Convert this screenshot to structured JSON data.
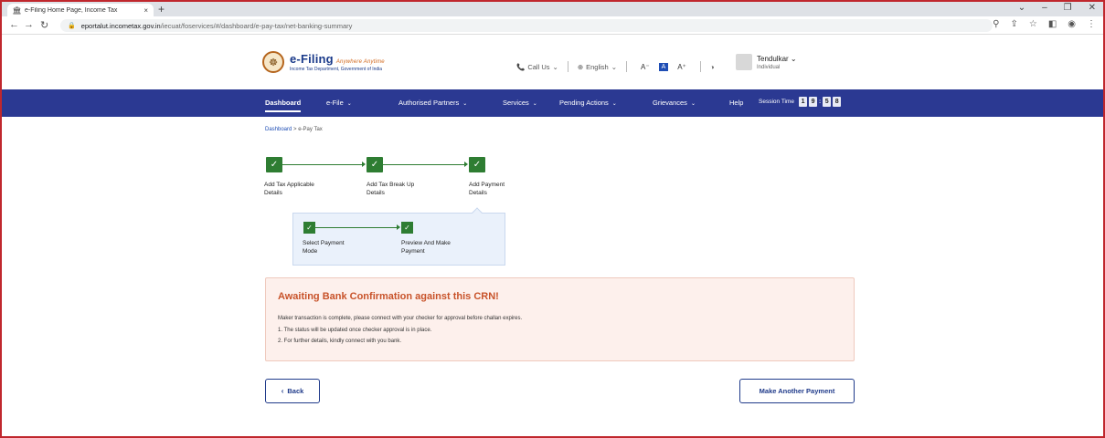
{
  "browser": {
    "tab_title": "e-Filing Home Page, Income Tax",
    "tab_close": "×",
    "new_tab": "+",
    "url_host": "eportalut.incometax.gov.in",
    "url_path": "/iecuat/foservices/#/dashboard/e-pay-tax/net-banking-summary",
    "icons": [
      "back-icon",
      "forward-icon",
      "reload-icon",
      "lock-icon",
      "zoom-icon",
      "share-icon",
      "star-icon",
      "sidepanel-icon",
      "profile-icon",
      "menu-icon"
    ]
  },
  "header": {
    "logo_main": "e-Filing",
    "logo_tagline": "Anywhere Anytime",
    "logo_sub": "Income Tax Department, Government of India",
    "call_us": "Call Us",
    "language": "English",
    "font_small": "A⁻",
    "font_normal": "A",
    "font_large": "A⁺",
    "user_name": "Tendulkar",
    "user_role": "Individual"
  },
  "nav": {
    "items": [
      {
        "label": "Dashboard",
        "caret": ""
      },
      {
        "label": "e-File",
        "caret": "⌄"
      },
      {
        "label": "Authorised Partners",
        "caret": "⌄"
      },
      {
        "label": "Services",
        "caret": "⌄"
      },
      {
        "label": "Pending Actions",
        "caret": "⌄"
      },
      {
        "label": "Grievances",
        "caret": "⌄"
      },
      {
        "label": "Help",
        "caret": ""
      }
    ],
    "session_label": "Session Time",
    "session_digits": [
      "1",
      "9",
      "5",
      "8"
    ]
  },
  "breadcrumb": {
    "home": "Dashboard",
    "separator": ">",
    "current": "e-Pay Tax"
  },
  "steps": [
    {
      "line1": "Add Tax Applicable",
      "line2": "Details"
    },
    {
      "line1": "Add Tax Break Up",
      "line2": "Details"
    },
    {
      "line1": "Add Payment",
      "line2": "Details"
    }
  ],
  "substeps": [
    {
      "line1": "Select Payment",
      "line2": "Mode"
    },
    {
      "line1": "Preview And Make",
      "line2": "Payment"
    }
  ],
  "alert": {
    "title": "Awaiting Bank Confirmation against this CRN!",
    "message": "Maker transaction is complete, please connect with your checker for approval before challan expires.",
    "point1": "1. The status will be updated once checker approval is in place.",
    "point2": "2. For further details, kindly connect with you bank."
  },
  "actions": {
    "back": "Back",
    "make_another": "Make Another Payment"
  },
  "colors": {
    "nav_bg": "#2b3992",
    "step_green": "#2e7d32",
    "alert_bg": "#fdf0ec",
    "alert_title": "#c8532a",
    "button_border": "#1f3a8a"
  }
}
